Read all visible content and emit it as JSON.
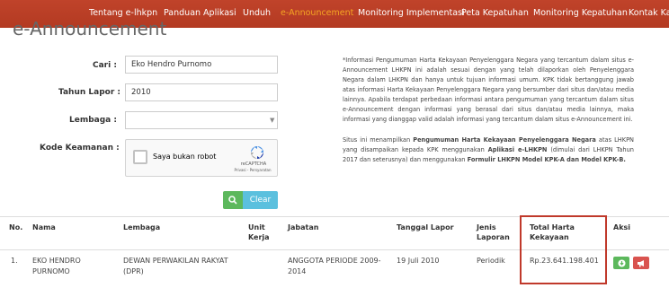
{
  "nav": {
    "items": [
      {
        "label": "Tentang e-lhkpn",
        "active": false
      },
      {
        "label": "Panduan Aplikasi",
        "active": false
      },
      {
        "label": "Unduh",
        "active": false
      },
      {
        "label": "e-Announcement",
        "active": true
      },
      {
        "label": "Monitoring Implementasi",
        "active": false
      },
      {
        "label": "Peta Kepatuhan",
        "active": false
      },
      {
        "label": "Monitoring Kepatuhan",
        "active": false
      },
      {
        "label": "Kontak Kam",
        "active": false
      }
    ],
    "colors": {
      "background": "#b83d25",
      "active": "#f5a623",
      "text": "#ffffff"
    }
  },
  "page": {
    "title": "e-Announcement"
  },
  "form": {
    "cari_label": "Cari :",
    "cari_value": "Eko Hendro Purnomo",
    "tahun_label": "Tahun Lapor :",
    "tahun_value": "2010",
    "lembaga_label": "Lembaga :",
    "lembaga_value": "",
    "kode_label": "Kode Keamanan :",
    "recaptcha_label": "Saya bukan robot",
    "recaptcha_brand": "reCAPTCHA",
    "recaptcha_links": "Privasi - Persyaratan",
    "clear_label": "Clear",
    "search_icon": "search-icon"
  },
  "info": {
    "para1": "*Informasi Pengumuman Harta Kekayaan Penyelenggara Negara yang tercantum dalam situs e-Announcement LHKPN ini adalah sesuai dengan yang telah dilaporkan oleh Penyelenggara Negara dalam LHKPN dan hanya untuk tujuan informasi umum. KPK tidak bertanggung jawab atas informasi Harta Kekayaan Penyelenggara Negara yang bersumber dari situs dan/atau media lainnya. Apabila terdapat perbedaan informasi antara pengumuman yang tercantum dalam situs e-Announcement dengan informasi yang berasal dari situs dan/atau media lainnya, maka informasi yang dianggap valid adalah informasi yang tercantum dalam situs e-Announcement ini.",
    "para2_a": "Situs ini menampilkan ",
    "para2_b": "Pengumuman Harta Kekayaan Penyelenggara Negara",
    "para2_c": " atas LHKPN yang disampaikan kepada KPK menggunakan ",
    "para2_d": "Aplikasi e-LHKPN",
    "para2_e": " (dimulai dari LHKPN Tahun 2017 dan seterusnya) dan menggunakan ",
    "para2_f": "Formulir LHKPN Model KPK-A dan Model KPK-B."
  },
  "table": {
    "headers": {
      "no": "No.",
      "nama": "Nama",
      "lembaga": "Lembaga",
      "unit_kerja_1": "Unit",
      "unit_kerja_2": "Kerja",
      "jabatan": "Jabatan",
      "tanggal": "Tanggal Lapor",
      "jenis_1": "Jenis",
      "jenis_2": "Laporan",
      "total_1": "Total Harta",
      "total_2": "Kekayaan",
      "aksi": "Aksi"
    },
    "rows": [
      {
        "no": "1.",
        "nama_1": "EKO HENDRO",
        "nama_2": "PURNOMO",
        "lembaga_1": "DEWAN PERWAKILAN RAKYAT",
        "lembaga_2": "(DPR)",
        "unit_kerja": "",
        "jabatan_1": "ANGGOTA PERIODE 2009-",
        "jabatan_2": "2014",
        "tanggal": "19 Juli 2010",
        "jenis": "Periodik",
        "total": "Rp.23.641.198.401",
        "actions": [
          "download-icon",
          "announce-icon"
        ]
      }
    ],
    "highlight_color": "#c0392b"
  }
}
